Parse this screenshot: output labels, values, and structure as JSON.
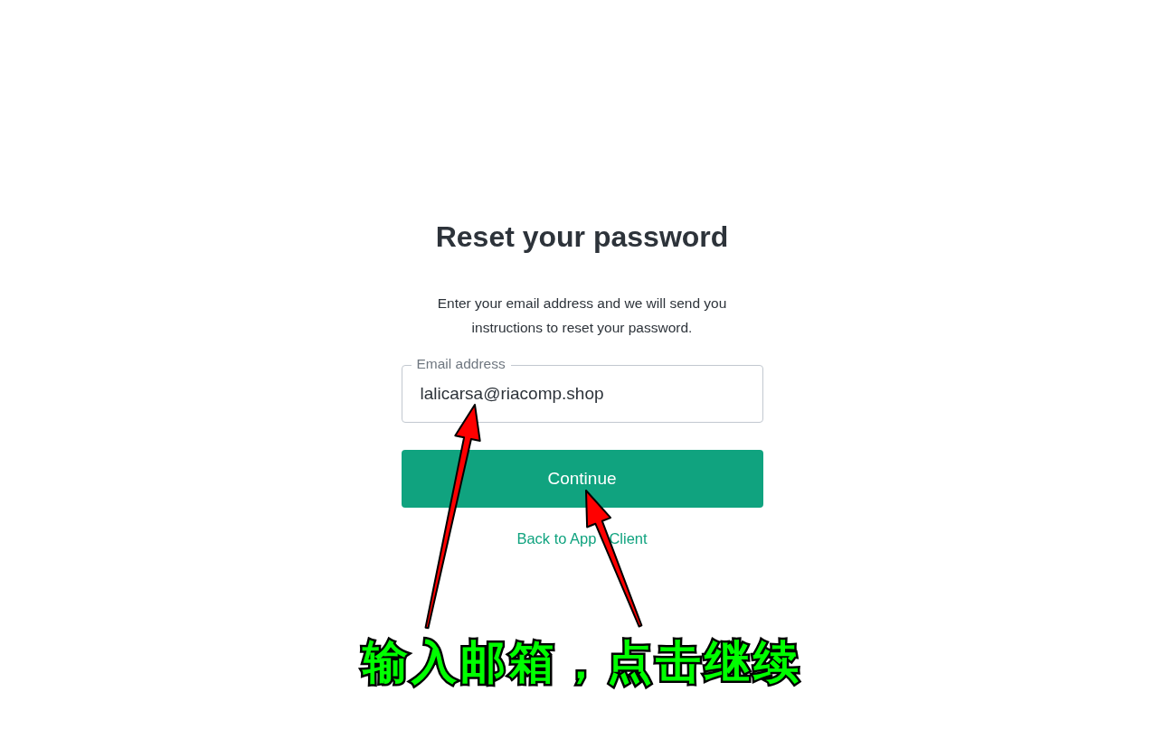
{
  "title": "Reset your password",
  "description": "Enter your email address and we will send you instructions to reset your password.",
  "email_field": {
    "label": "Email address",
    "value": "lalicarsa@riacomp.shop"
  },
  "continue_button": "Continue",
  "back_link": {
    "before_arrow": "Back to App",
    "after_arrow": "Client"
  },
  "annotation": {
    "caption": "输入邮箱，点击继续"
  }
}
